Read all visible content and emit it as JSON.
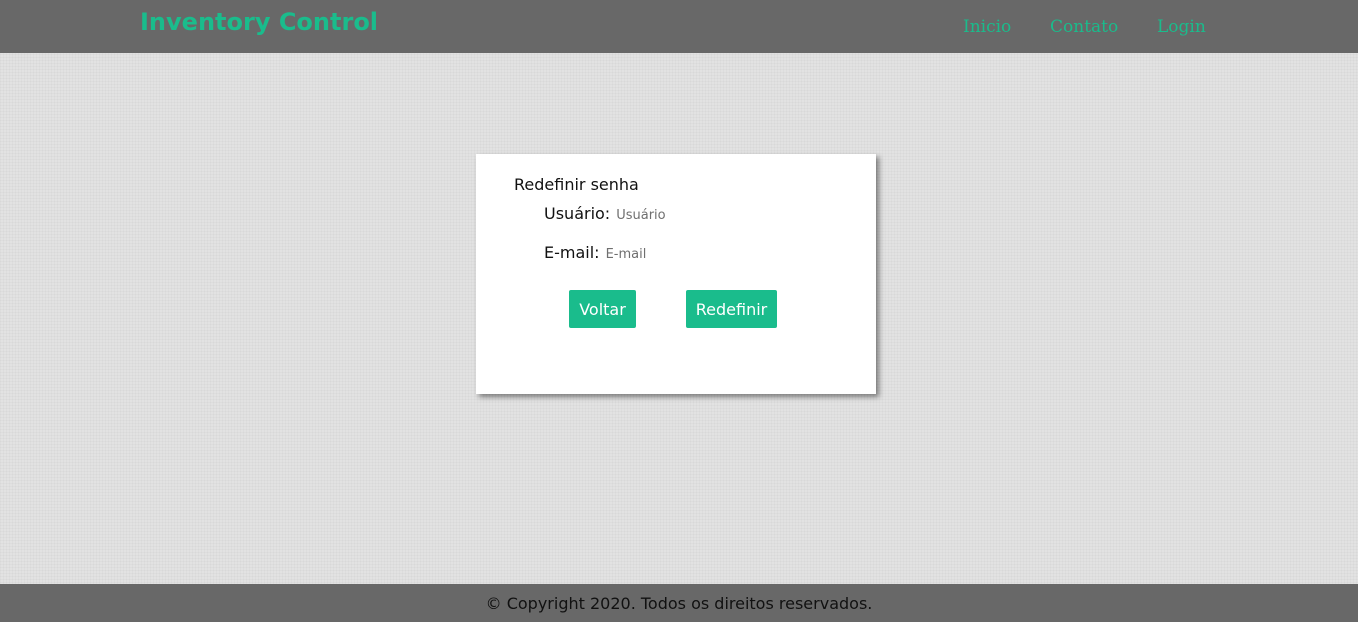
{
  "header": {
    "brand": "Inventory Control",
    "nav": {
      "inicio": "Inicio",
      "contato": "Contato",
      "login": "Login"
    }
  },
  "form": {
    "title": "Redefinir senha",
    "username": {
      "label": "Usuário:",
      "value": "",
      "placeholder": "Usuário"
    },
    "email": {
      "label": "E-mail:",
      "value": "",
      "placeholder": "E-mail"
    },
    "back_label": "Voltar",
    "submit_label": "Redefinir"
  },
  "footer": {
    "copyright": "© Copyright 2020. Todos os direitos reservados."
  },
  "colors": {
    "accent": "#1abc8c",
    "bar": "#686868",
    "background": "#e2e2e2"
  }
}
